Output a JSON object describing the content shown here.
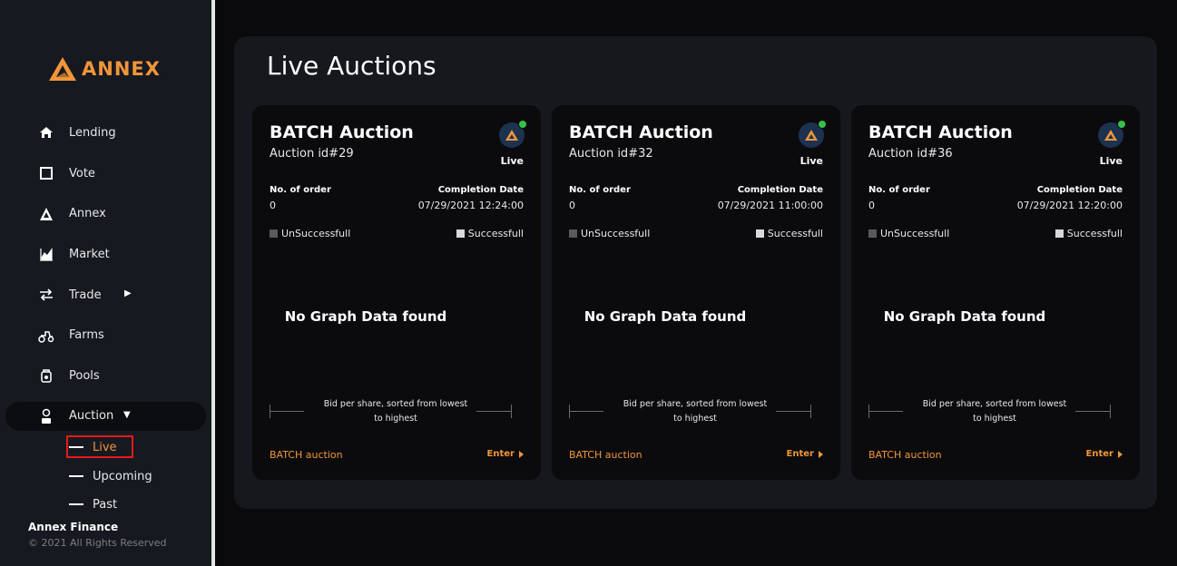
{
  "brand": {
    "name": "ANNEX",
    "accent": "#f1953a"
  },
  "sidebar": {
    "items": [
      {
        "label": "Lending",
        "icon": "home-icon"
      },
      {
        "label": "Vote",
        "icon": "square-icon"
      },
      {
        "label": "Annex",
        "icon": "annex-logo-icon"
      },
      {
        "label": "Market",
        "icon": "chart-icon"
      },
      {
        "label": "Trade",
        "icon": "swap-icon"
      },
      {
        "label": "Farms",
        "icon": "tractor-icon"
      },
      {
        "label": "Pools",
        "icon": "pool-icon"
      },
      {
        "label": "Auction",
        "icon": "auction-icon"
      }
    ],
    "auction_sub": [
      {
        "label": "Live"
      },
      {
        "label": "Upcoming"
      },
      {
        "label": "Past"
      }
    ],
    "footer_title": "Annex Finance",
    "footer_copy": "© 2021 All Rights Reserved"
  },
  "main": {
    "title": "Live Auctions",
    "cards": [
      {
        "title": "BATCH Auction",
        "auction_id": "Auction id#29",
        "status": "Live",
        "orders_label": "No. of order",
        "orders_value": "0",
        "completion_label": "Completion Date",
        "completion_value": "07/29/2021 12:24:00",
        "legend_unsuccessful": "UnSuccessfull",
        "legend_successful": "Successfull",
        "no_data": "No Graph Data found",
        "axis_label": "Bid per share, sorted from lowest to highest",
        "footer_left": "BATCH auction",
        "footer_right": "Enter"
      },
      {
        "title": "BATCH Auction",
        "auction_id": "Auction id#32",
        "status": "Live",
        "orders_label": "No. of order",
        "orders_value": "0",
        "completion_label": "Completion Date",
        "completion_value": "07/29/2021 11:00:00",
        "legend_unsuccessful": "UnSuccessfull",
        "legend_successful": "Successfull",
        "no_data": "No Graph Data found",
        "axis_label": "Bid per share, sorted from lowest to highest",
        "footer_left": "BATCH auction",
        "footer_right": "Enter"
      },
      {
        "title": "BATCH Auction",
        "auction_id": "Auction id#36",
        "status": "Live",
        "orders_label": "No. of order",
        "orders_value": "0",
        "completion_label": "Completion Date",
        "completion_value": "07/29/2021 12:20:00",
        "legend_unsuccessful": "UnSuccessfull",
        "legend_successful": "Successfull",
        "no_data": "No Graph Data found",
        "axis_label": "Bid per share, sorted from lowest to highest",
        "footer_left": "BATCH auction",
        "footer_right": "Enter"
      }
    ]
  },
  "colors": {
    "unsuccessful": "#5a5a5a",
    "successful": "#d9d9d9",
    "live_dot": "#35c24a",
    "highlight_box": "#e31b1b"
  }
}
